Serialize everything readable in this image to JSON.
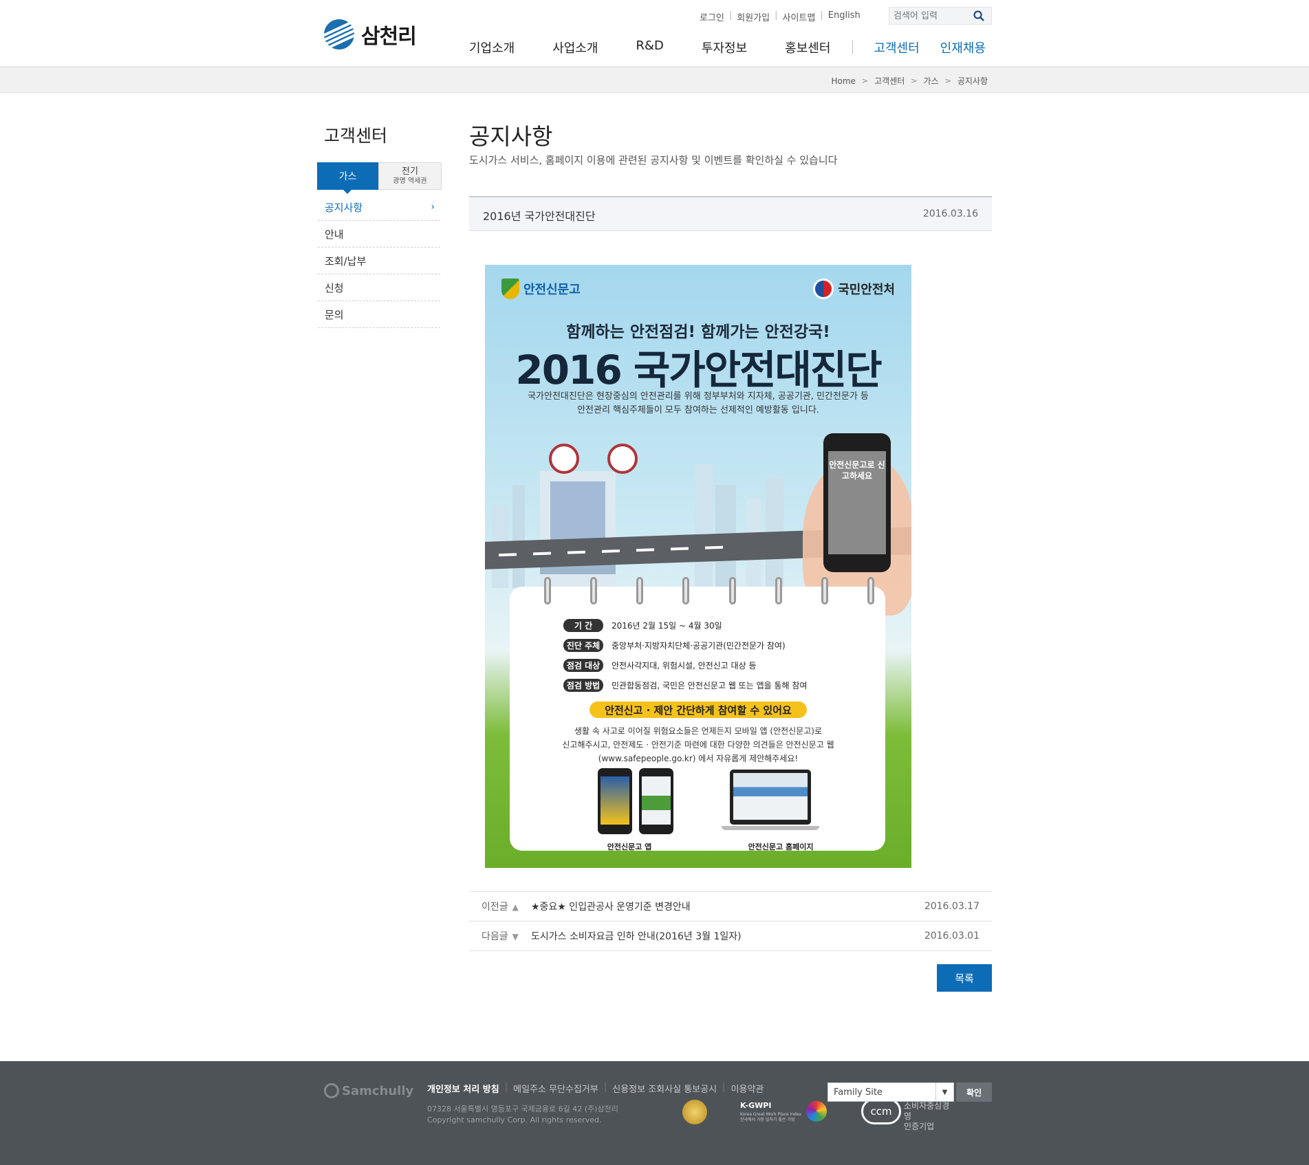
{
  "brand": {
    "name": "삼천리",
    "footer_name": "Samchully"
  },
  "util_links": [
    "로그인",
    "회원가입",
    "사이트맵",
    "English"
  ],
  "search": {
    "placeholder": "검색어 입력"
  },
  "gnb": [
    "기업소개",
    "사업소개",
    "R&D",
    "투자정보",
    "홍보센터",
    "고객센터",
    "인재채용"
  ],
  "breadcrumb": [
    "Home",
    "고객센터",
    "가스",
    "공지사항"
  ],
  "lnb": {
    "title": "고객센터",
    "tab_gas": "가스",
    "tab_elec": "전기",
    "tab_elec_sub": "광명 역세권",
    "items": [
      "공지사항",
      "안내",
      "조회/납부",
      "신청",
      "문의"
    ]
  },
  "page": {
    "title": "공지사항",
    "desc": "도시가스 서비스, 홈페이지 이용에 관련된 공지사항 및 이벤트를 확인하실 수 있습니다"
  },
  "post": {
    "title": "2016년 국가안전대진단",
    "date": "2016.03.16"
  },
  "poster": {
    "logo_left": "안전신문고",
    "logo_right": "국민안전처",
    "slogan": "함께하는 안전점검! 함께가는 안전강국!",
    "title": "2016 국가안전대진단",
    "intro1": "국가안전대진단은 현장중심의 안전관리를 위해 정부부처와 지자체, 공공기관, 민간전문가 등",
    "intro2": "안전관리 핵심주체들이 모두 참여하는 선제적인 예방활동 입니다.",
    "phone_text": "안전신문고로 신고하세요",
    "rows": [
      {
        "label": "기 간",
        "text": "2016년 2월 15일 ~ 4월 30일"
      },
      {
        "label": "진단 주체",
        "text": "중앙부처·지방자치단체·공공기관(민간전문가 참여)"
      },
      {
        "label": "점검 대상",
        "text": "안전사각지대, 위험시설, 안전신고 대상 등"
      },
      {
        "label": "점검 방법",
        "text": "민관합동점검, 국민은 안전신문고 웹 또는 앱을 통해 참여"
      }
    ],
    "banner": "안전신고 · 제안 간단하게 참여할 수 있어요",
    "body1": "생활 속 사고로 이어질 위험요소들은 언제든지 모바일 앱 (안전신문고)로",
    "body2": "신고해주시고, 안전제도 · 안전기준 마련에 대한 다양한 의견들은 안전신문고 웹",
    "body3": "(www.safepeople.go.kr) 에서 자유롭게 제안해주세요!",
    "cap_app": "안전신문고 앱",
    "cap_web": "안전신문고 홈페이지"
  },
  "prev": {
    "label": "이전글",
    "title": "★중요★ 인입관공사 운영기준 변경안내",
    "date": "2016.03.17"
  },
  "next": {
    "label": "다음글",
    "title": "도시가스 소비자요금 인하 안내(2016년 3월 1일자)",
    "date": "2016.03.01"
  },
  "list_button": "목록",
  "footer": {
    "links": [
      "개인정보 처리 방침",
      "메일주소 무단수집거부",
      "신용정보 조회사실 통보공시",
      "이용약관"
    ],
    "address": "07328 서울특별시 영등포구 국제금융로 6길 42 (주)삼천리",
    "copyright": "Copyright samchully Corp. All rights reserved.",
    "kgwpi": "K-GWPI",
    "kgwpi_sub": "Korea Great Work Place Index 한국에서 가장 일하기 좋은 기업",
    "ccm": "ccm",
    "ccm_text1": "소비자중심경영",
    "ccm_text2": "인증기업",
    "family_site": "Family Site",
    "confirm": "확인"
  },
  "colors": {
    "accent": "#0d6cb6",
    "footer_bg": "#4e5357",
    "banner": "#f4c21b"
  }
}
